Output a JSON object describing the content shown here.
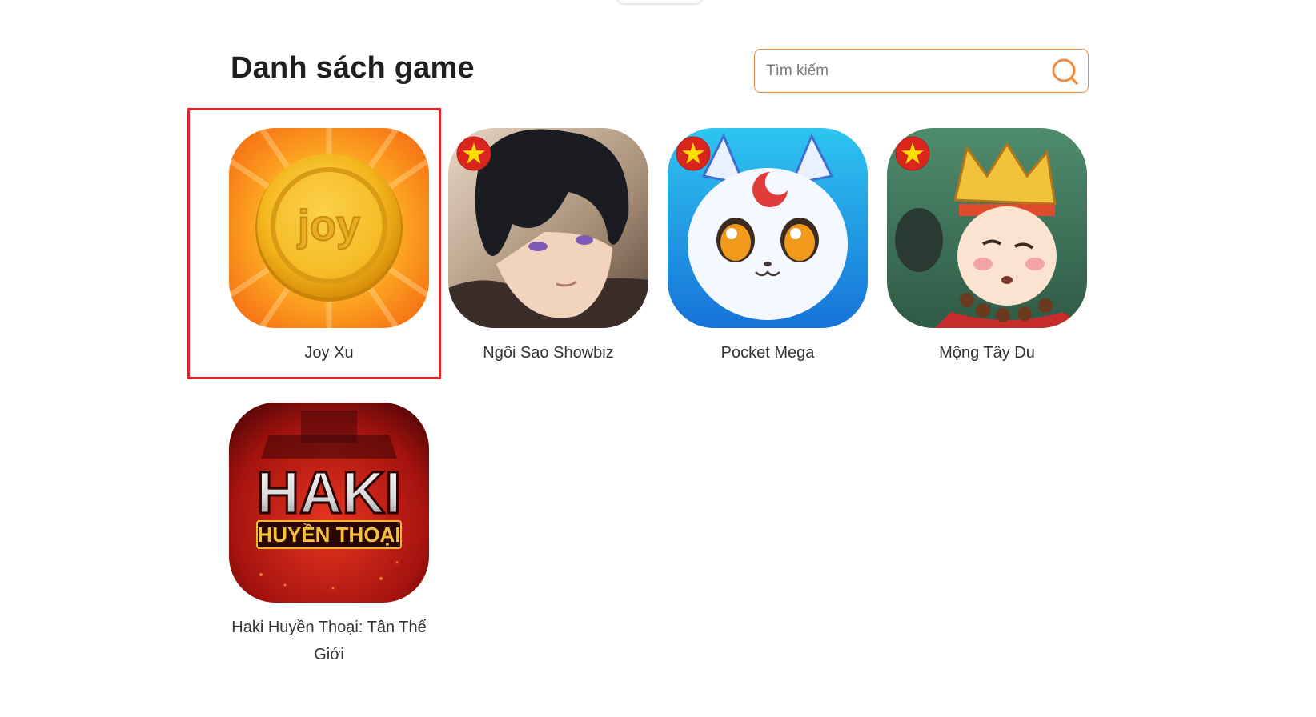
{
  "header": {
    "title": "Danh sách game"
  },
  "search": {
    "placeholder": "Tìm kiếm",
    "value": ""
  },
  "games": [
    {
      "name": "Joy Xu",
      "icon": "joy-coin-icon",
      "badge": false,
      "coin_text": "joy"
    },
    {
      "name": "Ngôi Sao Showbiz",
      "icon": "ngoi-sao-showbiz-icon",
      "badge": true
    },
    {
      "name": "Pocket Mega",
      "icon": "pocket-mega-icon",
      "badge": true
    },
    {
      "name": "Mộng Tây Du",
      "icon": "mong-tay-du-icon",
      "badge": true
    },
    {
      "name": "Haki Huyền Thoại: Tân Thế Giới",
      "icon": "haki-huyen-thoai-icon",
      "badge": false,
      "logo_line1": "HAKI",
      "logo_line2": "HUYỀN THOẠI"
    }
  ],
  "badge": {
    "icon": "vietnam-flag-badge-icon",
    "color": "#da251d",
    "star_color": "#ffde00"
  },
  "colors": {
    "accent": "#f28a3c",
    "highlight": "#e0222a",
    "title": "#1f1f1f"
  }
}
